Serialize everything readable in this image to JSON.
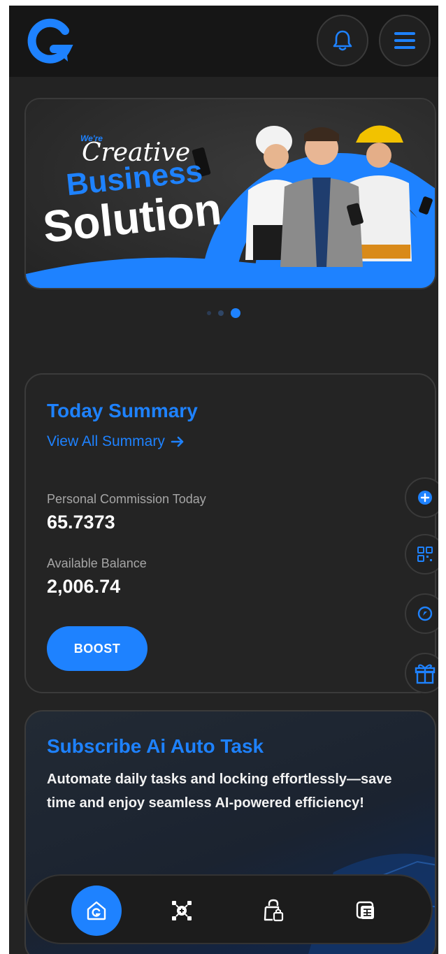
{
  "header": {
    "logo_icon": "g-logo-icon",
    "notification_icon": "bell-icon",
    "menu_icon": "hamburger-menu-icon"
  },
  "banner": {
    "small_text": "We're",
    "line1": "Creative",
    "line2": "Business",
    "line3": "Solution"
  },
  "carousel": {
    "count": 3,
    "active_index": 2
  },
  "summary": {
    "title": "Today Summary",
    "view_all": "View All Summary",
    "commission_label": "Personal Commission Today",
    "commission_value": "65.7373",
    "balance_label": "Available Balance",
    "balance_value": "2,006.74",
    "boost_label": "BOOST"
  },
  "ai_task": {
    "title": "Subscribe Ai Auto Task",
    "description": "Automate daily tasks and locking effortlessly—save time and enjoy seamless AI-powered efficiency!"
  },
  "side_actions": [
    "plus-circle-icon",
    "qr-code-icon",
    "compass-icon",
    "gift-icon"
  ],
  "bottom_nav": [
    "home-icon",
    "task-grid-icon",
    "lock-bag-icon",
    "wallet-icon"
  ],
  "colors": {
    "accent": "#1e82ff",
    "background": "#232323",
    "card_border": "#3b3b3b",
    "text_muted": "#a6a6a6"
  }
}
